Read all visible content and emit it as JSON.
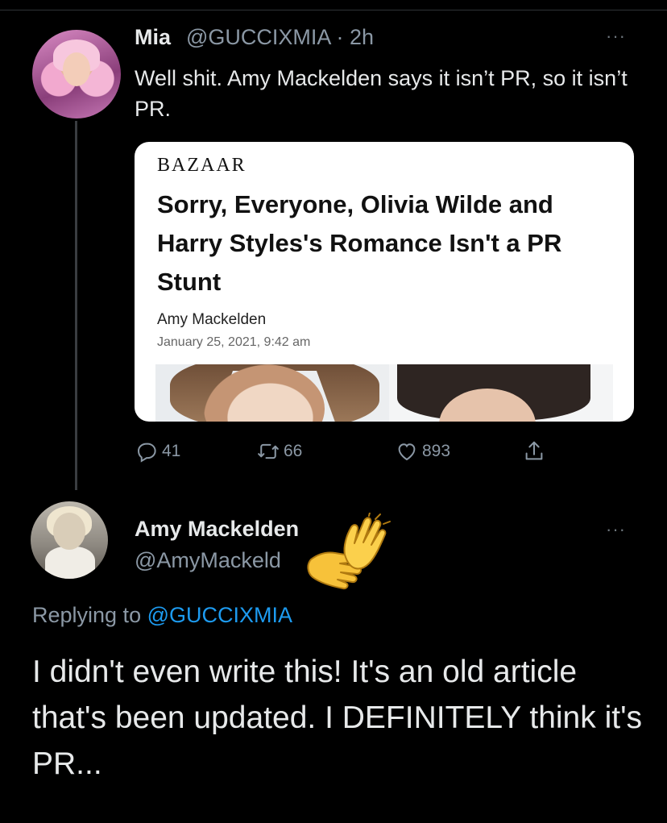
{
  "tweet1": {
    "name": "Mia",
    "handle": "@GUCCIXMIA",
    "time": "2h",
    "body": "Well shit. Amy Mackelden says it isn’t PR, so it isn’t PR.",
    "more": "···",
    "card": {
      "brand": "BAZAAR",
      "headline": "Sorry, Everyone, Olivia Wilde and Harry Styles's Romance Isn't a PR Stunt",
      "author": "Amy Mackelden",
      "date": "January 25, 2021, 9:42 am"
    },
    "actions": {
      "replies": "41",
      "retweets": "66",
      "likes": "893"
    }
  },
  "tweet2": {
    "name": "Amy Mackelden",
    "handle": "@AmyMackeld",
    "more": "···",
    "replying_prefix": "Replying to",
    "replying_to": "@GUCCIXMIA",
    "body": "I didn't even write this! It's an old article that's been updated. I DEFINITELY think it's PR..."
  },
  "colors": {
    "background": "#000000",
    "text": "#e7e9ea",
    "muted": "#8b98a5",
    "accent": "#1d9bf0"
  },
  "icons": {
    "reply": "reply-icon",
    "retweet": "retweet-icon",
    "like": "heart-icon",
    "share": "share-icon",
    "overlay": "clapping-hands-emoji"
  }
}
